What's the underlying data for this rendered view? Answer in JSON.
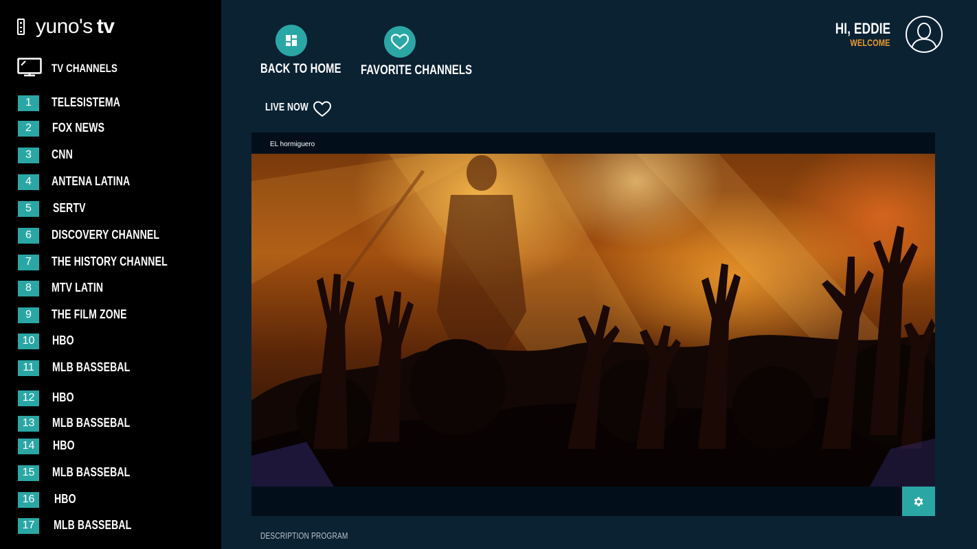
{
  "app": {
    "logo_text": "yuno's",
    "logo_suffix": "tv"
  },
  "sidebar": {
    "section_label": "TV CHANNELS",
    "channels": [
      {
        "num": "1",
        "name": "TELESISTEMA"
      },
      {
        "num": "2",
        "name": "FOX NEWS"
      },
      {
        "num": "3",
        "name": "CNN"
      },
      {
        "num": "4",
        "name": "ANTENA LATINA"
      },
      {
        "num": "5",
        "name": "SERTV"
      },
      {
        "num": "6",
        "name": "DISCOVERY CHANNEL"
      },
      {
        "num": "7",
        "name": "THE HISTORY CHANNEL"
      },
      {
        "num": "8",
        "name": "MTV LATIN"
      },
      {
        "num": "9",
        "name": "THE FILM ZONE"
      },
      {
        "num": "10",
        "name": "HBO"
      },
      {
        "num": "11",
        "name": "MLB BASSEBAL"
      },
      {
        "num": "12",
        "name": "HBO"
      },
      {
        "num": "13",
        "name": "MLB BASSEBAL"
      },
      {
        "num": "14",
        "name": "HBO"
      },
      {
        "num": "15",
        "name": "MLB BASSEBAL"
      },
      {
        "num": "16",
        "name": "HBO"
      },
      {
        "num": "17",
        "name": "MLB BASSEBAL"
      }
    ]
  },
  "header": {
    "back_home_label": "BACK TO HOME",
    "favorites_label": "FAVORITE CHANNELS",
    "user_greeting": "HI, EDDIE",
    "welcome": "WELCOME"
  },
  "live": {
    "label": "LIVE NOW"
  },
  "player": {
    "program_title": "EL hormiguero"
  },
  "description": {
    "label": "DESCRIPTION PROGRAM"
  },
  "colors": {
    "accent": "#2aa7a5",
    "welcome": "#f09a2e",
    "background": "#0b2233",
    "sidebar": "#000000"
  },
  "icons": [
    "remote-icon",
    "tv-icon",
    "grid-icon",
    "heart-icon",
    "avatar-icon",
    "gear-icon"
  ]
}
